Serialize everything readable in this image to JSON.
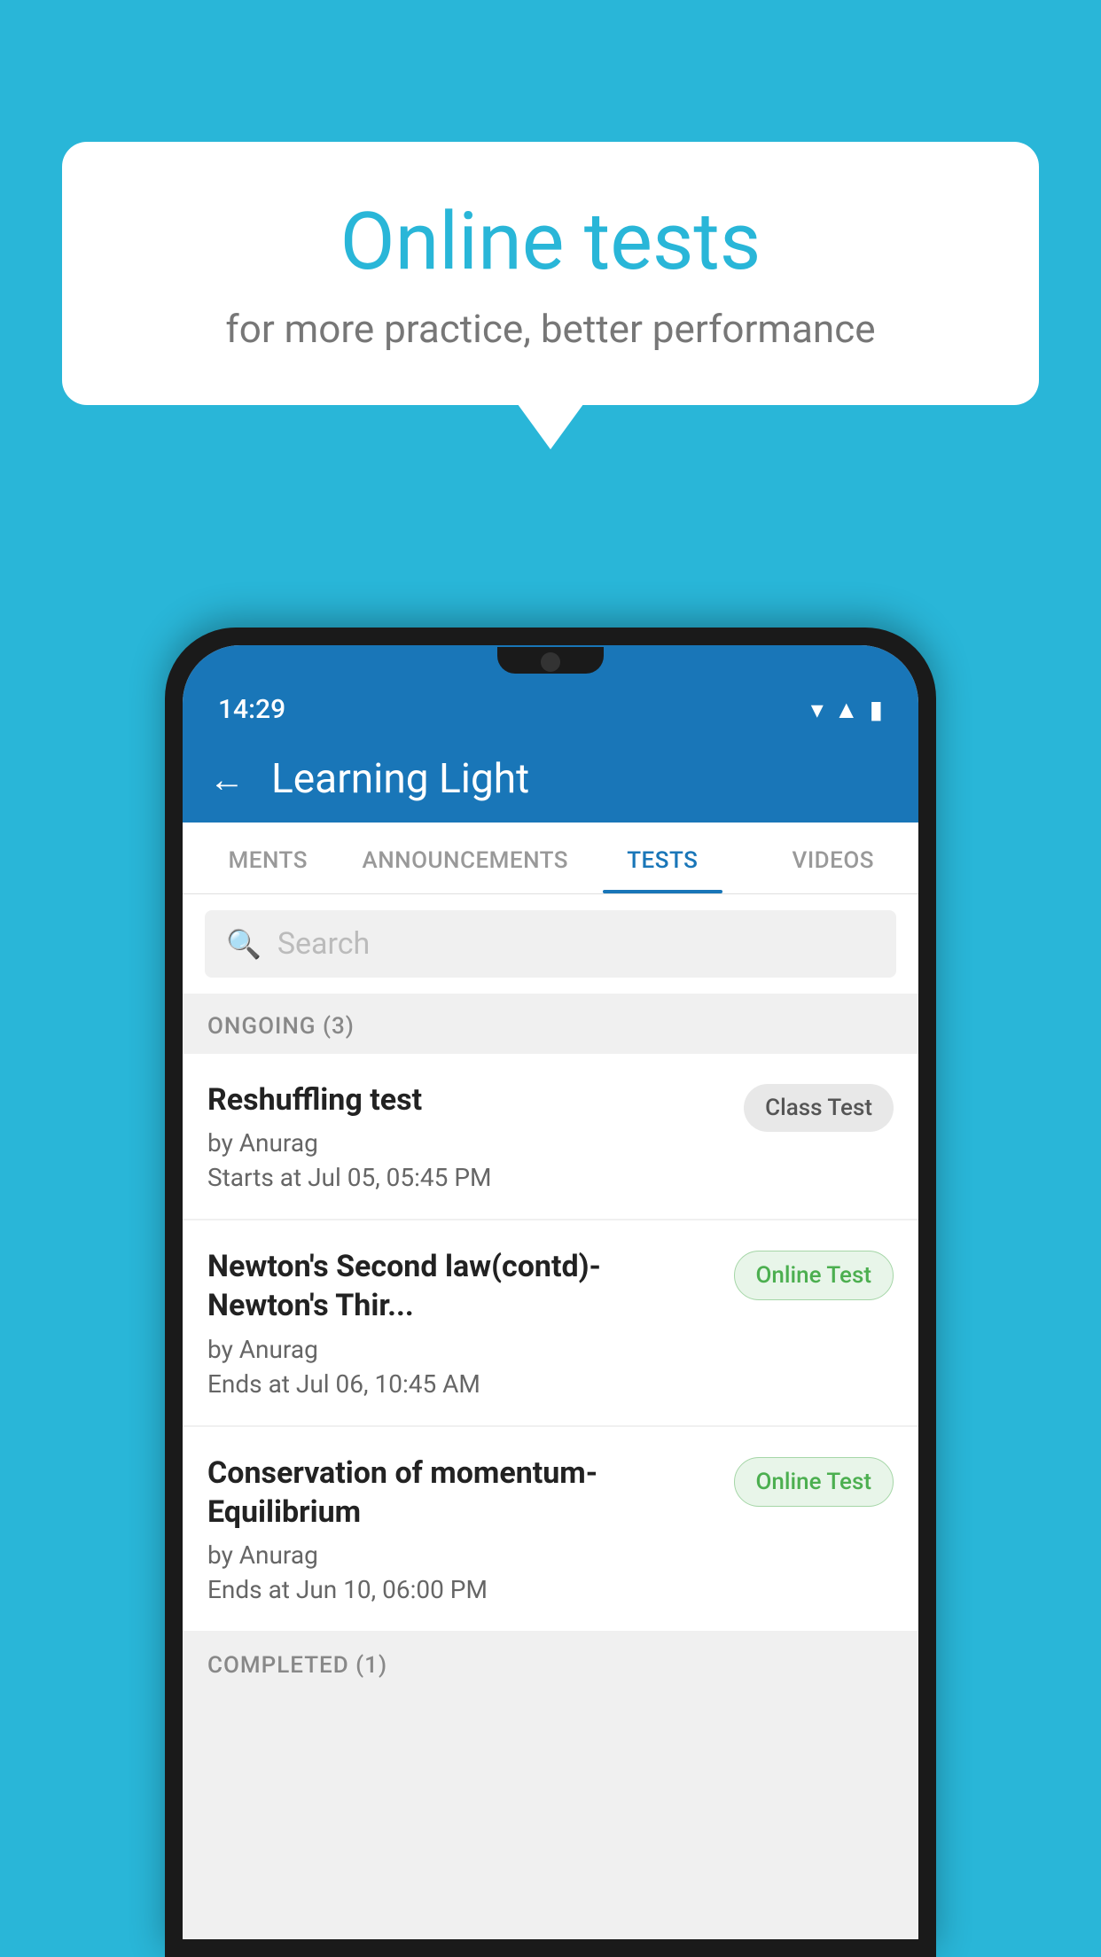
{
  "background": {
    "color": "#29b6d8"
  },
  "bubble": {
    "title": "Online tests",
    "subtitle": "for more practice, better performance"
  },
  "phone": {
    "status_bar": {
      "time": "14:29",
      "icons": [
        "wifi",
        "signal",
        "battery"
      ]
    },
    "app_bar": {
      "title": "Learning Light",
      "back_label": "←"
    },
    "tabs": [
      {
        "label": "MENTS",
        "active": false
      },
      {
        "label": "ANNOUNCEMENTS",
        "active": false
      },
      {
        "label": "TESTS",
        "active": true
      },
      {
        "label": "VIDEOS",
        "active": false
      }
    ],
    "search": {
      "placeholder": "Search"
    },
    "ongoing_section": {
      "header": "ONGOING (3)",
      "items": [
        {
          "name": "Reshuffling test",
          "by": "by Anurag",
          "time": "Starts at  Jul 05, 05:45 PM",
          "badge": "Class Test",
          "badge_type": "class"
        },
        {
          "name": "Newton's Second law(contd)-Newton's Thir...",
          "by": "by Anurag",
          "time": "Ends at  Jul 06, 10:45 AM",
          "badge": "Online Test",
          "badge_type": "online"
        },
        {
          "name": "Conservation of momentum-Equilibrium",
          "by": "by Anurag",
          "time": "Ends at  Jun 10, 06:00 PM",
          "badge": "Online Test",
          "badge_type": "online"
        }
      ]
    },
    "completed_section": {
      "header": "COMPLETED (1)"
    }
  }
}
